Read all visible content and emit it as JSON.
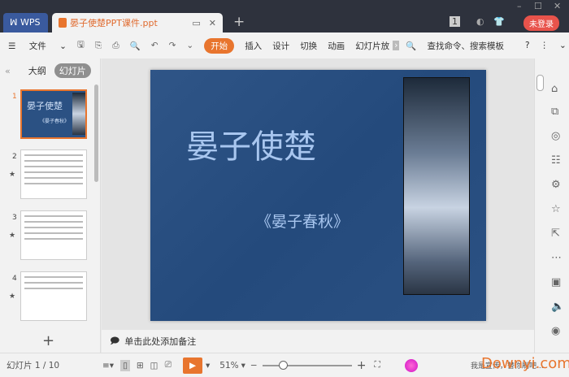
{
  "titlebar": {
    "wps_label": "WPS",
    "doc_tab": "晏子使楚PPT课件.ppt",
    "new_tab": "+",
    "badge": "1",
    "login": "未登录"
  },
  "toolbar": {
    "file": "文件",
    "tabs": [
      "开始",
      "插入",
      "设计",
      "切换",
      "动画",
      "幻灯片放"
    ],
    "search": "查找命令、搜索模板",
    "help": "?"
  },
  "left_panel": {
    "outline_tab": "大纲",
    "slides_tab": "幻灯片",
    "slide_numbers": [
      "1",
      "2",
      "3",
      "4"
    ],
    "add": "+"
  },
  "slide": {
    "title": "晏子使楚",
    "subtitle": "《晏子春秋》",
    "thumb_title": "晏子使楚",
    "thumb_sub": "《晏子春秋》"
  },
  "notes": {
    "placeholder": "单击此处添加备注"
  },
  "status": {
    "slide_counter": "幻灯片 1 / 10",
    "zoom": "51%",
    "user_text": "我是宣传，替你刷吧...",
    "watermark": "Downyi.com"
  },
  "zoom_level_percent": 51
}
